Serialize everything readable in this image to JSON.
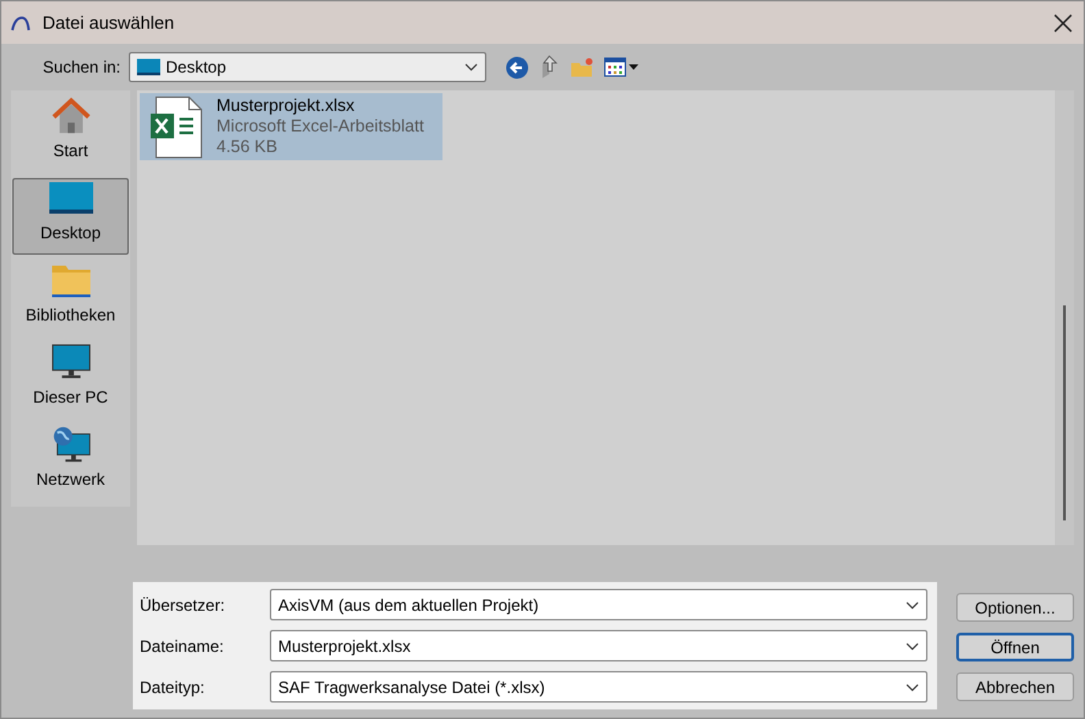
{
  "window": {
    "title": "Datei auswählen"
  },
  "look_in": {
    "label": "Suchen in:",
    "value": "Desktop"
  },
  "sidebar": {
    "items": [
      {
        "label": "Start",
        "kind": "home",
        "selected": false
      },
      {
        "label": "Desktop",
        "kind": "desktop",
        "selected": true
      },
      {
        "label": "Bibliotheken",
        "kind": "folder",
        "selected": false
      },
      {
        "label": "Dieser PC",
        "kind": "pc",
        "selected": false
      },
      {
        "label": "Netzwerk",
        "kind": "network",
        "selected": false
      }
    ]
  },
  "files": [
    {
      "name": "Musterprojekt.xlsx",
      "type": "Microsoft Excel-Arbeitsblatt",
      "size": "4.56 KB",
      "selected": true
    }
  ],
  "fields": [
    {
      "label": "Übersetzer:",
      "value": "AxisVM (aus dem aktuellen Projekt)"
    },
    {
      "label": "Dateiname:",
      "value": "Musterprojekt.xlsx"
    },
    {
      "label": "Dateityp:",
      "value": "SAF Tragwerksanalyse Datei (*.xlsx)"
    }
  ],
  "buttons": [
    {
      "label": "Optionen...",
      "default": false
    },
    {
      "label": "Öffnen",
      "default": true
    },
    {
      "label": "Abbrechen",
      "default": false
    }
  ]
}
